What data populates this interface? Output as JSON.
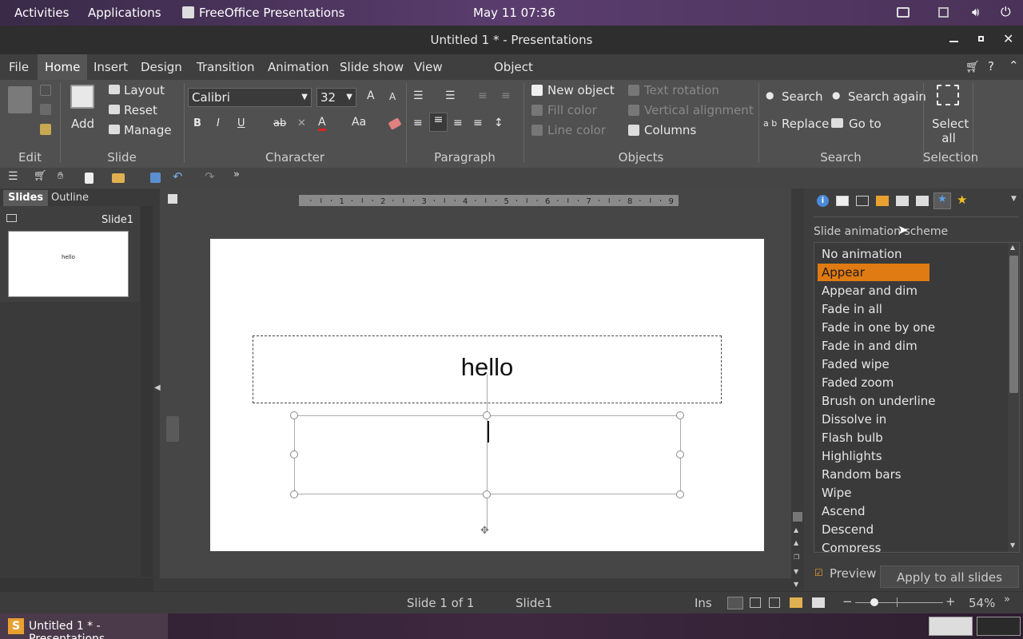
{
  "gnome": {
    "activities": "Activities",
    "applications": "Applications",
    "app_name": "FreeOffice Presentations",
    "datetime": "May 11  07:36"
  },
  "window": {
    "title": "Untitled 1 * - Presentations"
  },
  "menu": [
    "File",
    "Home",
    "Insert",
    "Design",
    "Transition",
    "Animation",
    "Slide show",
    "View",
    "Object"
  ],
  "ribbon": {
    "edit_group": "Edit",
    "slide_group": "Slide",
    "add": "Add",
    "layout": "Layout",
    "reset": "Reset",
    "manage": "Manage",
    "character_group": "Character",
    "font_name": "Calibri",
    "font_size": "32",
    "paragraph_group": "Paragraph",
    "objects_group": "Objects",
    "new_object": "New object",
    "fill_color": "Fill color",
    "line_color": "Line color",
    "text_rotation": "Text rotation",
    "vertical_alignment": "Vertical alignment",
    "columns": "Columns",
    "search_group": "Search",
    "search": "Search",
    "search_again": "Search again",
    "replace": "Replace",
    "go_to": "Go to",
    "selection_group": "Selection",
    "select_all": "Select all"
  },
  "slides_pane": {
    "tab_slides": "Slides",
    "tab_outline": "Outline",
    "thumb_label": "Slide1",
    "thumb_text": "hello"
  },
  "ruler": {
    "numbers": [
      "1",
      "2",
      "3",
      "4",
      "5",
      "6",
      "7",
      "8",
      "9"
    ]
  },
  "slide": {
    "title_text": "hello"
  },
  "sidebar": {
    "heading": "Slide animation scheme",
    "items": [
      "No animation",
      "Appear",
      "Appear and dim",
      "Fade in all",
      "Fade in one by one",
      "Fade in and dim",
      "Faded wipe",
      "Faded zoom",
      "Brush on underline",
      "Dissolve in",
      "Flash bulb",
      "Highlights",
      "Random bars",
      "Wipe",
      "Ascend",
      "Descend",
      "Compress"
    ],
    "selected": "Appear",
    "preview": "Preview",
    "apply_all": "Apply to all slides"
  },
  "status": {
    "slide_of": "Slide 1 of 1",
    "slide_name": "Slide1",
    "mode": "Ins",
    "zoom": "54%"
  },
  "taskbar": {
    "app": "Untitled 1 * - Presentations"
  },
  "colors": {
    "accent": "#e07a12",
    "underline_red": "#e02020"
  }
}
